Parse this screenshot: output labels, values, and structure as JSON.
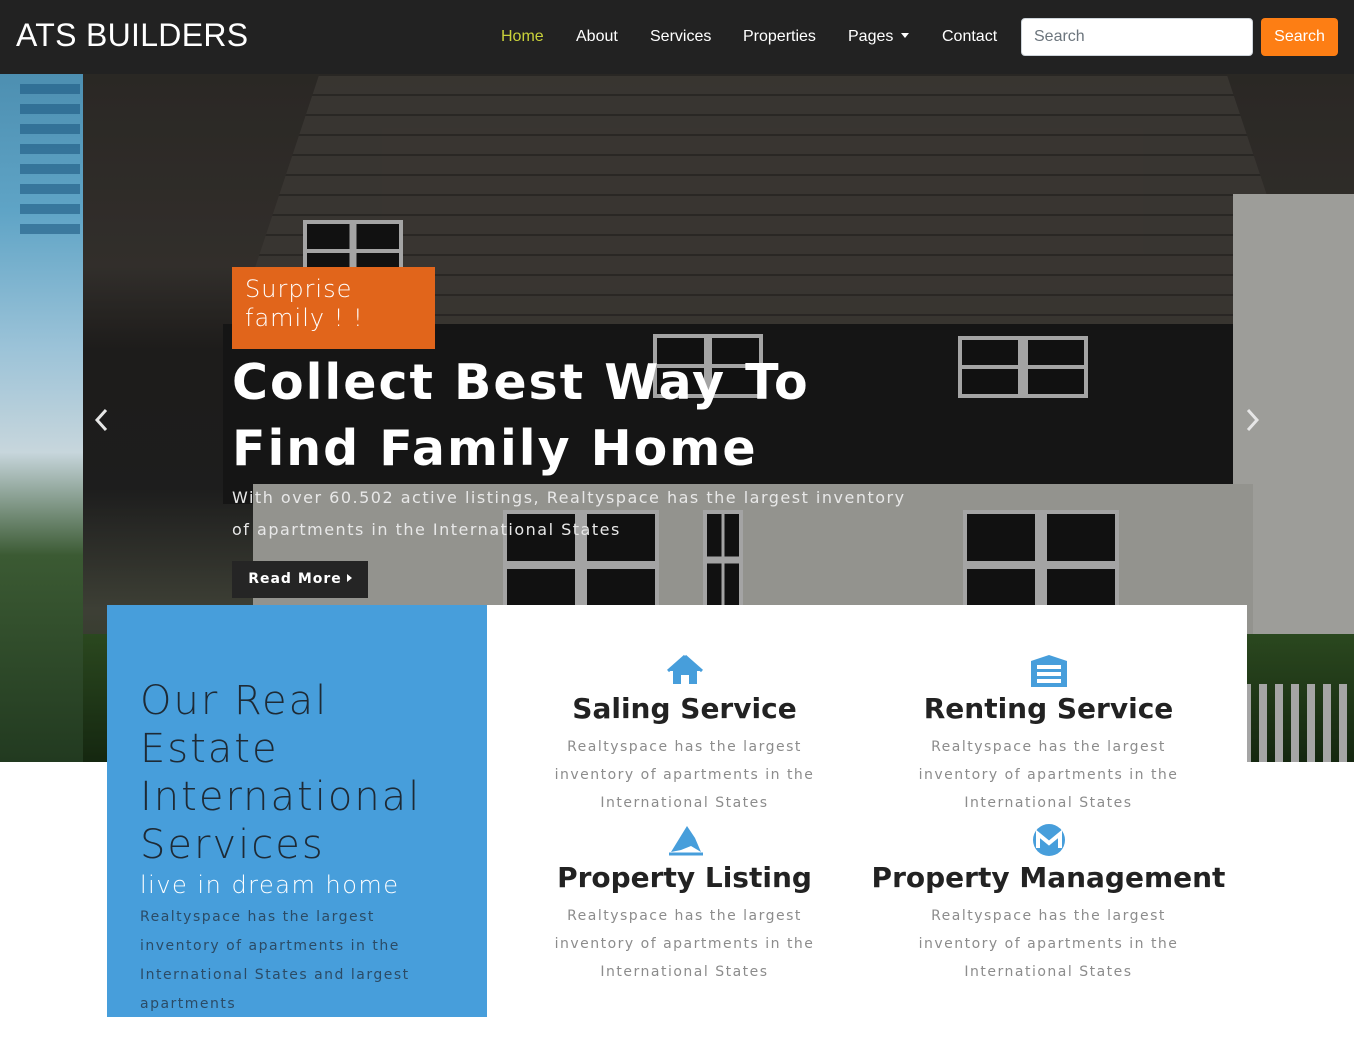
{
  "header": {
    "brand": "ATS BUILDERS",
    "nav": [
      {
        "label": "Home",
        "active": true
      },
      {
        "label": "About"
      },
      {
        "label": "Services"
      },
      {
        "label": "Properties"
      },
      {
        "label": "Pages",
        "dropdown": true
      },
      {
        "label": "Contact"
      }
    ],
    "search_placeholder": "Search",
    "search_button": "Search"
  },
  "hero": {
    "tag": "Surprise family ! !",
    "title": "Collect Best Way To Find Family Home",
    "text": "With over 60.502 active listings, Realtyspace has the largest inventory of apartments in the International States",
    "read_more": "Read More"
  },
  "intro": {
    "title": "Our Real Estate International Services",
    "subtitle": "live in dream home",
    "text": "Realtyspace has the largest inventory of apartments in the International States and largest apartments"
  },
  "services": [
    {
      "icon": "home-icon",
      "title": "Saling Service",
      "text": "Realtyspace has the largest inventory of apartments in the International States"
    },
    {
      "icon": "warehouse-icon",
      "title": "Renting Service",
      "text": "Realtyspace has the largest inventory of apartments in the International States"
    },
    {
      "icon": "listing-icon",
      "title": "Property Listing",
      "text": "Realtyspace has the largest inventory of apartments in the International States"
    },
    {
      "icon": "monero-icon",
      "title": "Property Management",
      "text": "Realtyspace has the largest inventory of apartments in the International States"
    }
  ],
  "colors": {
    "navbar": "#222222",
    "accent_orange": "#fd7e14",
    "tag_orange": "#e1651b",
    "nav_active": "#c9d23a",
    "blue_box": "#479edb",
    "service_icon": "#479edb"
  }
}
